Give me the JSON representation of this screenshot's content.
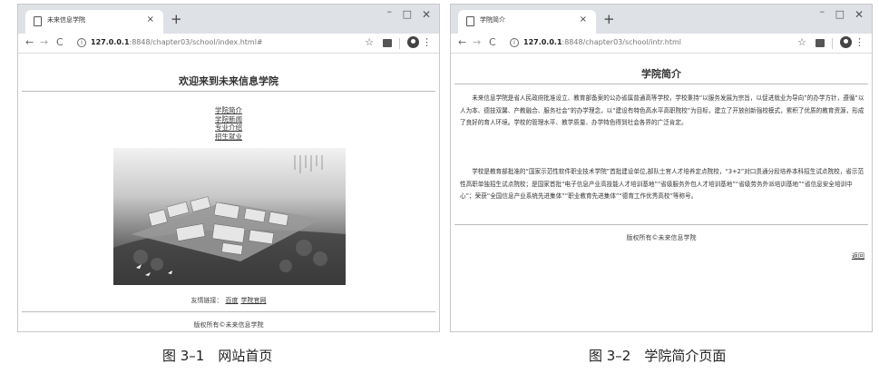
{
  "figure_a": {
    "tab_title": "未来信息学院",
    "url_host": "127.0.0.1",
    "url_path": ":8848/chapter03/school/index.html#",
    "heading": "欢迎来到未来信息学院",
    "nav_links": [
      "学院简介",
      "学院新闻",
      "专业介绍",
      "招生就业"
    ],
    "friend_label": "友情链接：",
    "friend_links": [
      "百度",
      "学院官网"
    ],
    "copyright": "版权所有©未来信息学院",
    "caption": "图 3–1　网站首页"
  },
  "figure_b": {
    "tab_title": "学院简介",
    "url_host": "127.0.0.1",
    "url_path": ":8848/chapter03/school/intr.html",
    "heading": "学院简介",
    "paragraphs": [
      "未来信息学院是省人民政府批准设立、教育部备案的公办省属普通高等学校，学校秉持“以服务发展为宗旨，以促进就业为导向”的办学方针，遵循“以人为本、德技双馨、产教融合、服务社会”的办学理念，以“建设有特色高水平高职院校”为目标，建立了开放创新强校模式，累积了优质的教育资源，形成了良好的育人环境。学校的管理水平、教学质量、办学特色得到社会各界的广泛肯定。",
      "学校是教育部批准的“国家示范性软件职业技术学院”首批建设单位,部队士官人才培养定点院校，“3+2”对口贯通分段培养本科招生试点院校，省示范性高职单独招生试点院校；是国家首批“电子信息产业高技能人才培训基地”“省级服务外包人才培训基地”“省级劳务外派培训基地”“省信息安全培训中心”；荣获“全国信息产业系统先进集体”“职业教育先进集体”“德育工作优秀高校”等称号。"
    ],
    "copyright": "版权所有©未来信息学院",
    "back_link": "返回",
    "caption": "图 3–2　学院简介页面"
  },
  "browser": {
    "new_tab_symbol": "+",
    "close_symbol": "×",
    "minimize_symbol": "–",
    "maximize_symbol": "□",
    "window_close_symbol": "✕",
    "back_symbol": "←",
    "forward_symbol": "→",
    "reload_symbol": "C",
    "star_symbol": "☆",
    "more_symbol": "⋮",
    "info_symbol": "i"
  }
}
